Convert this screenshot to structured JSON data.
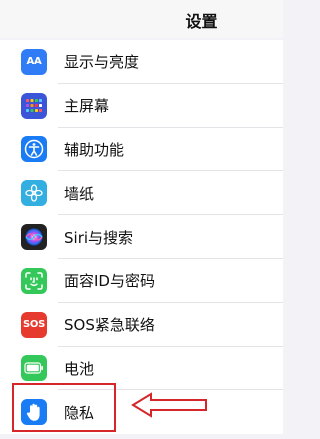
{
  "nav": {
    "title": "设置"
  },
  "settings": {
    "items": [
      {
        "label": "显示与亮度",
        "icon": "display-brightness-icon",
        "color": "#2f7cf6",
        "icon_text": "AA"
      },
      {
        "label": "主屏幕",
        "icon": "home-screen-icon",
        "color": "#3b55d9"
      },
      {
        "label": "辅助功能",
        "icon": "accessibility-icon",
        "color": "#1a7cf5"
      },
      {
        "label": "墙纸",
        "icon": "wallpaper-icon",
        "color": "#33aee0"
      },
      {
        "label": "Siri与搜索",
        "icon": "siri-icon",
        "color": "#222222"
      },
      {
        "label": "面容ID与密码",
        "icon": "face-id-icon",
        "color": "#34c759"
      },
      {
        "label": "SOS紧急联络",
        "icon": "sos-icon",
        "color": "#e63a2e",
        "icon_text": "SOS"
      },
      {
        "label": "电池",
        "icon": "battery-icon",
        "color": "#34c759"
      },
      {
        "label": "隐私",
        "icon": "privacy-hand-icon",
        "color": "#1a7cf5"
      }
    ]
  },
  "annotation": {
    "highlight_color": "#d6262a",
    "highlighted_item": "隐私"
  }
}
